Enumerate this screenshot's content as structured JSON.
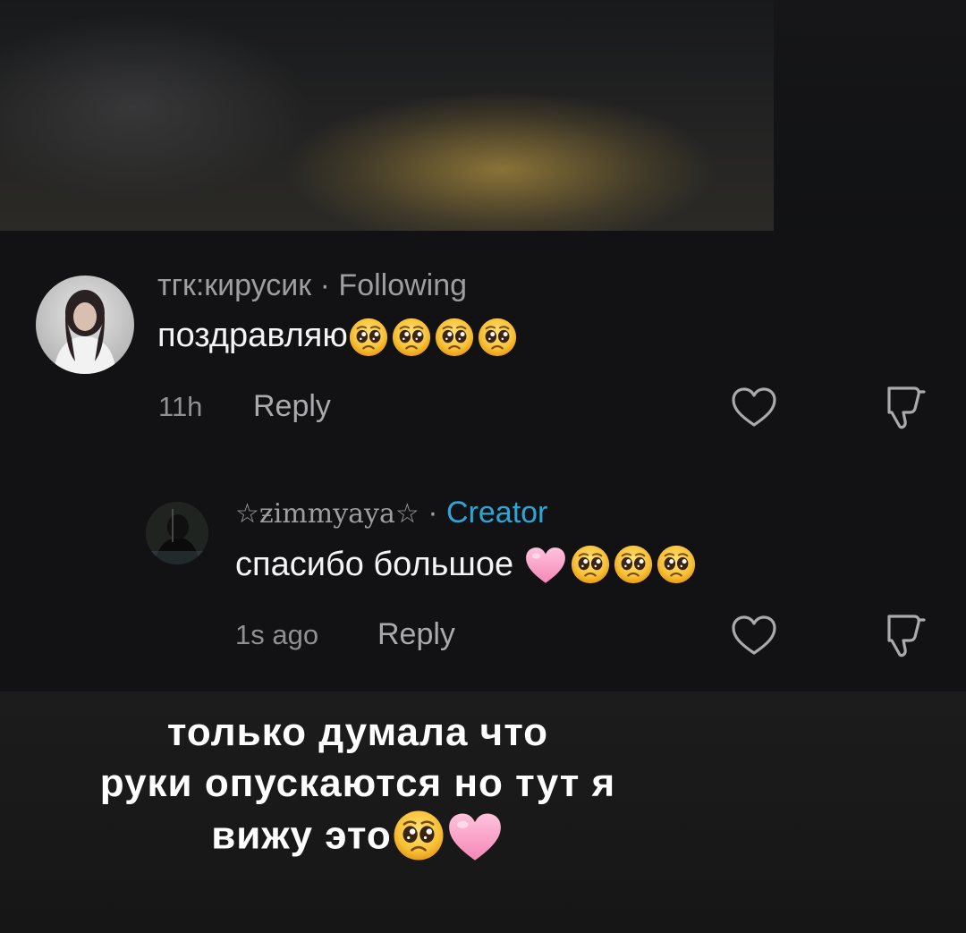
{
  "comments": [
    {
      "username": "тгк:кирусик",
      "separator": "·",
      "tag": "Following",
      "text": "поздравляю",
      "emojis": [
        "pleading-face",
        "pleading-face",
        "pleading-face",
        "pleading-face"
      ],
      "time": "11h",
      "reply_label": "Reply"
    },
    {
      "username": "☆ƶimmyaya☆",
      "separator": "·",
      "tag": "Creator",
      "text": "спасибо большое",
      "emojis": [
        "pink-heart",
        "pleading-face",
        "pleading-face",
        "pleading-face"
      ],
      "time": "1s ago",
      "reply_label": "Reply"
    }
  ],
  "caption": {
    "line1": "только думала что",
    "line2": "руки опускаются но тут я",
    "line3": "вижу это",
    "emojis": [
      "pleading-face",
      "pink-heart"
    ]
  },
  "icons": {
    "like": "heart-outline-icon",
    "dislike": "thumbs-down-outline-icon"
  },
  "colors": {
    "background": "#121214",
    "username": "#9d9da2",
    "creator_accent": "#2aa7d6",
    "text": "#f4f4f4",
    "caption": "#ffffff"
  }
}
